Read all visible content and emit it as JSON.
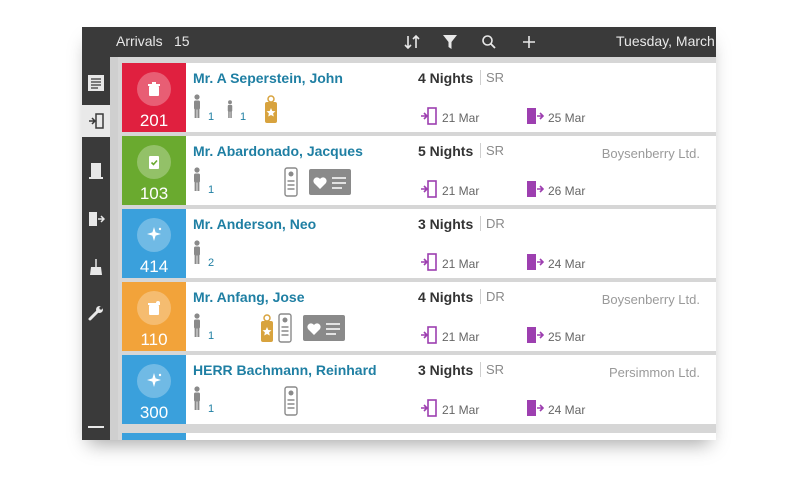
{
  "header": {
    "title": "Arrivals",
    "count": "15",
    "date": "Tuesday, March",
    "icons": [
      "sort-icon",
      "filter-icon",
      "search-icon",
      "add-icon"
    ]
  },
  "sidebar": {
    "items": [
      {
        "icon": "list-icon",
        "active": false
      },
      {
        "icon": "arrivals-icon",
        "active": true
      },
      {
        "icon": "in-house-icon",
        "active": false
      },
      {
        "icon": "departures-icon",
        "active": false
      },
      {
        "icon": "housekeeping-icon",
        "active": false
      },
      {
        "icon": "maintenance-icon",
        "active": false
      }
    ]
  },
  "colors": {
    "red": "#e0203f",
    "green": "#6aaa2f",
    "blue": "#3aa0dc",
    "orange": "#f2a33a",
    "name": "#1f7fa3",
    "purple": "#9d3fb0"
  },
  "reservations": [
    {
      "name": "Mr. A Seperstein, John",
      "nights": "4 Nights",
      "room_type": "SR",
      "company": "",
      "room": "201",
      "status_color": "#e0203f",
      "status_icon": "trash-icon",
      "adults": "1",
      "children": "1",
      "arrival": "21 Mar",
      "departure": "25 Mar",
      "extras": [
        "vip-tag-icon"
      ]
    },
    {
      "name": "Mr. Abardonado, Jacques",
      "nights": "5 Nights",
      "room_type": "SR",
      "company": "Boysenberry Ltd.",
      "room": "103",
      "status_color": "#6aaa2f",
      "status_icon": "clipboard-check-icon",
      "adults": "1",
      "children": "",
      "arrival": "21 Mar",
      "departure": "26 Mar",
      "extras": [
        "id-card-icon",
        "loyalty-card-icon"
      ]
    },
    {
      "name": "Mr. Anderson, Neo",
      "nights": "3 Nights",
      "room_type": "DR",
      "company": "",
      "room": "414",
      "status_color": "#3aa0dc",
      "status_icon": "sparkle-icon",
      "adults": "2",
      "children": "",
      "arrival": "21 Mar",
      "departure": "24 Mar",
      "extras": []
    },
    {
      "name": "Mr. Anfang, Jose",
      "nights": "4 Nights",
      "room_type": "DR",
      "company": "Boysenberry Ltd.",
      "room": "110",
      "status_color": "#f2a33a",
      "status_icon": "dirty-trash-icon",
      "adults": "1",
      "children": "",
      "arrival": "21 Mar",
      "departure": "25 Mar",
      "extras": [
        "vip-tag-icon",
        "id-card-icon",
        "loyalty-card-icon"
      ]
    },
    {
      "name": "HERR Bachmann, Reinhard",
      "nights": "3 Nights",
      "room_type": "SR",
      "company": "Persimmon Ltd.",
      "room": "300",
      "status_color": "#3aa0dc",
      "status_icon": "sparkle-icon",
      "adults": "1",
      "children": "",
      "arrival": "21 Mar",
      "departure": "24 Mar",
      "extras": [
        "id-card-icon"
      ]
    }
  ]
}
